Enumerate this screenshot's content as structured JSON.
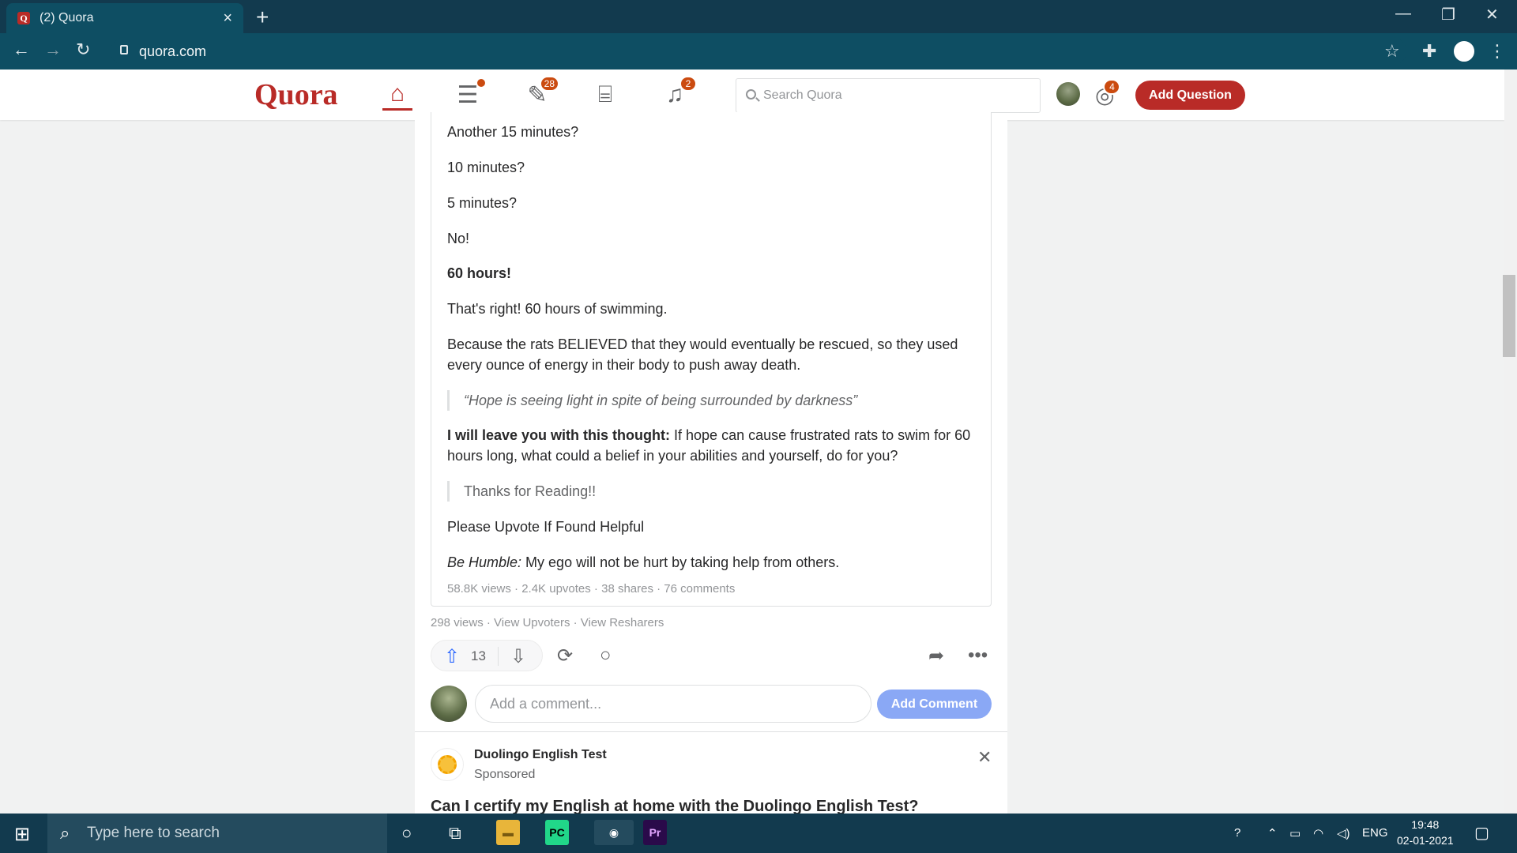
{
  "browser": {
    "tab_title": "(2) Quora",
    "tab_favicon": "Q",
    "url": "quora.com"
  },
  "header": {
    "logo": "Quora",
    "badges": {
      "answer": "28",
      "notifications": "2",
      "languages": "4"
    },
    "search_placeholder": "Search Quora",
    "add_question": "Add Question"
  },
  "answer": {
    "paragraphs": [
      "Another 15 minutes?",
      "10 minutes?",
      "5 minutes?",
      "No!",
      "60 hours!",
      "That's right! 60 hours of swimming.",
      "Because the rats BELIEVED that they would eventually be rescued, so they used every ounce of energy in their body to push away death."
    ],
    "quote1": "“Hope is seeing light in spite of being surrounded by darkness”",
    "thought_bold": "I will leave you with this thought:",
    "thought_rest": " If hope can cause frustrated rats to swim for 60 hours long, what could a belief in your abilities and yourself, do for you?",
    "quote2": "Thanks for Reading!!",
    "upvote_line": "Please Upvote If Found Helpful",
    "humble_italic": "Be Humble:",
    "humble_rest": " My ego will not be hurt by taking help from others.",
    "stats": "58.8K views · 2.4K upvotes · 38 shares · 76 comments"
  },
  "share_meta": "298 views · View Upvoters · View Resharers",
  "actions": {
    "upvotes": "13"
  },
  "comment": {
    "placeholder": "Add a comment...",
    "button": "Add Comment"
  },
  "ad": {
    "name": "Duolingo English Test",
    "sponsored": "Sponsored",
    "question": "Can I certify my English at home with the Duolingo English Test?"
  },
  "taskbar": {
    "search_placeholder": "Type here to search",
    "language": "ENG",
    "time": "19:48",
    "date": "02-01-2021"
  },
  "colors": {
    "brand": "#b92b27",
    "accent": "#2e69ff",
    "badge": "#cb4b10"
  }
}
